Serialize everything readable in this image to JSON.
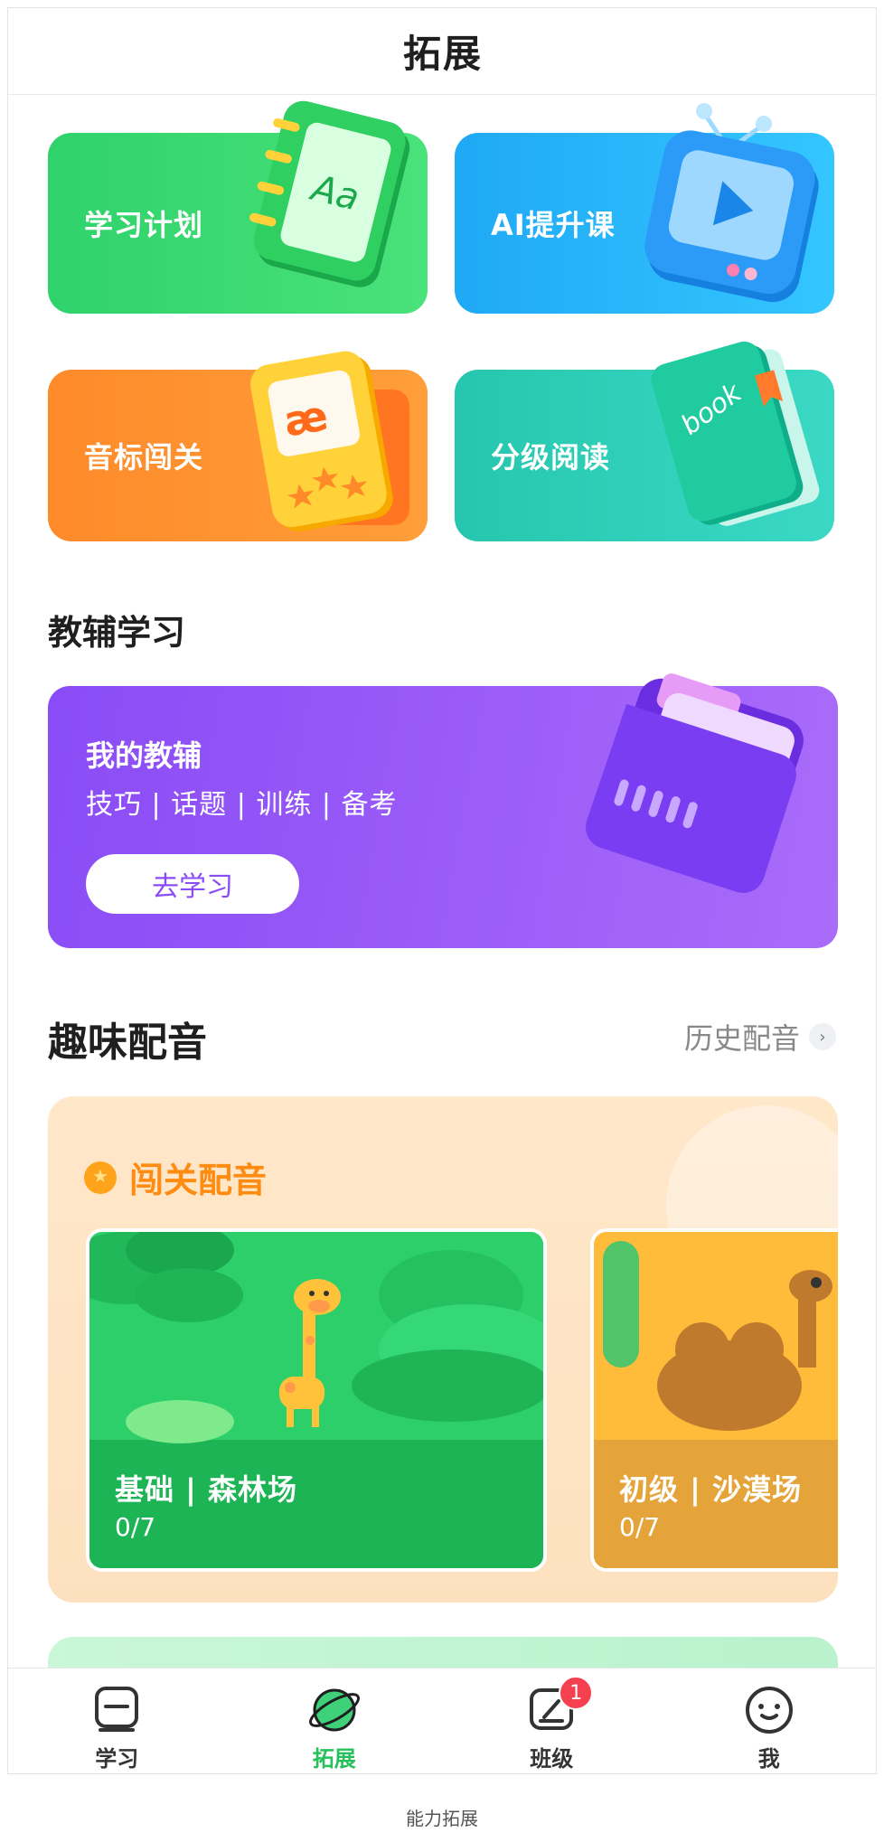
{
  "header": {
    "title": "拓展"
  },
  "tiles": [
    {
      "label": "学习计划",
      "icon": "notebook-icon"
    },
    {
      "label": "AI提升课",
      "icon": "tv-play-icon"
    },
    {
      "label": "音标闯关",
      "icon": "phonics-card-icon"
    },
    {
      "label": "分级阅读",
      "icon": "book-icon"
    }
  ],
  "tutor_section": {
    "title": "教辅学习",
    "card_title": "我的教辅",
    "card_subtitle": "技巧 | 话题 | 训练 | 备考",
    "button_label": "去学习",
    "icon": "folder-icon"
  },
  "dubbing_section": {
    "title": "趣味配音",
    "history_label": "历史配音",
    "panel_title": "闯关配音",
    "scenes": [
      {
        "name": "基础 | 森林场",
        "progress": "0/7"
      },
      {
        "name": "初级 | 沙漠场",
        "progress": "0/7"
      }
    ]
  },
  "tabbar": {
    "items": [
      {
        "label": "学习",
        "icon": "study-icon"
      },
      {
        "label": "拓展",
        "icon": "planet-icon",
        "active": true
      },
      {
        "label": "班级",
        "icon": "class-icon",
        "badge": "1"
      },
      {
        "label": "我",
        "icon": "face-icon"
      }
    ]
  },
  "caption": "能力拓展",
  "colors": {
    "accent_green": "#26c15c",
    "tutor_purple": "#8a4cf6",
    "dubbing_orange": "#ff8c12",
    "badge_red": "#f5404f"
  }
}
